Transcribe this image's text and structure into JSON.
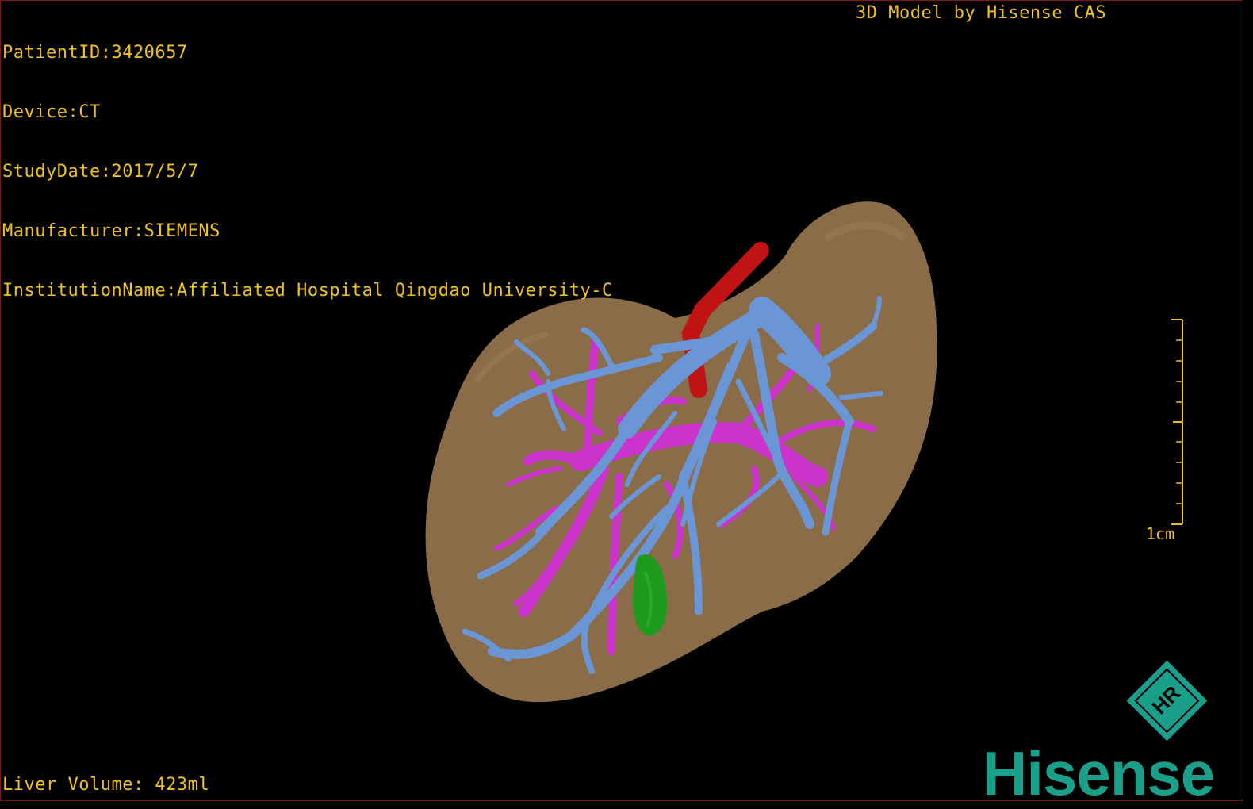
{
  "viewer": {
    "patient_id": "PatientID:3420657",
    "device": "Device:CT",
    "study_date": "StudyDate:2017/5/7",
    "manufacturer": "Manufacturer:SIEMENS",
    "institution": "InstitutionName:Affiliated Hospital Qingdao University-C",
    "model_credit": "3D Model by Hisense CAS",
    "liver_volume": "Liver Volume: 423ml",
    "scale_label": "1cm"
  },
  "branding": {
    "logo_text": "Hisense",
    "badge_text": "HR"
  },
  "colors": {
    "text": "#f0c020",
    "liver": "#8a6c48",
    "portal_vein": "#6a96d6",
    "hepatic_vein": "#cc33cc",
    "artery": "#c01414",
    "gallbladder": "#1e9a1e",
    "brand": "#1a9f8a",
    "frame": "#7a1a1a"
  }
}
